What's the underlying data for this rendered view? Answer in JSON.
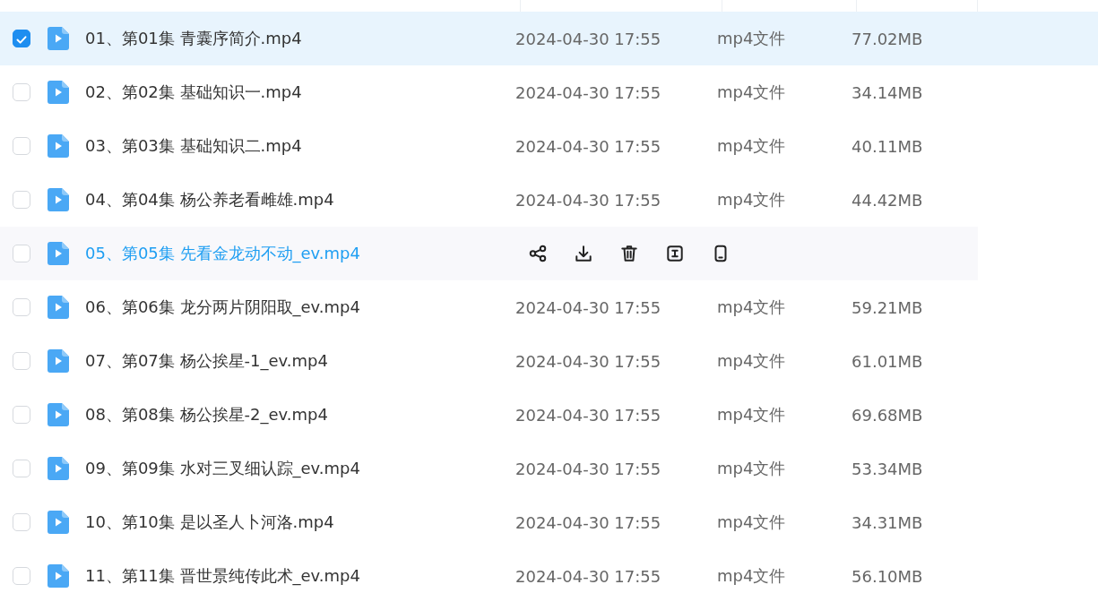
{
  "files": [
    {
      "name": "01、第01集 青囊序简介.mp4",
      "date": "2024-04-30 17:55",
      "type": "mp4文件",
      "size": "77.02MB",
      "checked": true,
      "selected": true,
      "hovered": false
    },
    {
      "name": "02、第02集 基础知识一.mp4",
      "date": "2024-04-30 17:55",
      "type": "mp4文件",
      "size": "34.14MB",
      "checked": false,
      "selected": false,
      "hovered": false
    },
    {
      "name": "03、第03集 基础知识二.mp4",
      "date": "2024-04-30 17:55",
      "type": "mp4文件",
      "size": "40.11MB",
      "checked": false,
      "selected": false,
      "hovered": false
    },
    {
      "name": "04、第04集 杨公养老看雌雄.mp4",
      "date": "2024-04-30 17:55",
      "type": "mp4文件",
      "size": "44.42MB",
      "checked": false,
      "selected": false,
      "hovered": false
    },
    {
      "name": "05、第05集 先看金龙动不动_ev.mp4",
      "checked": false,
      "selected": false,
      "hovered": true
    },
    {
      "name": "06、第06集 龙分两片阴阳取_ev.mp4",
      "date": "2024-04-30 17:55",
      "type": "mp4文件",
      "size": "59.21MB",
      "checked": false,
      "selected": false,
      "hovered": false
    },
    {
      "name": "07、第07集 杨公挨星-1_ev.mp4",
      "date": "2024-04-30 17:55",
      "type": "mp4文件",
      "size": "61.01MB",
      "checked": false,
      "selected": false,
      "hovered": false
    },
    {
      "name": "08、第08集 杨公挨星-2_ev.mp4",
      "date": "2024-04-30 17:55",
      "type": "mp4文件",
      "size": "69.68MB",
      "checked": false,
      "selected": false,
      "hovered": false
    },
    {
      "name": "09、第09集 水对三叉细认踪_ev.mp4",
      "date": "2024-04-30 17:55",
      "type": "mp4文件",
      "size": "53.34MB",
      "checked": false,
      "selected": false,
      "hovered": false
    },
    {
      "name": "10、第10集 是以圣人卜河洛.mp4",
      "date": "2024-04-30 17:55",
      "type": "mp4文件",
      "size": "34.31MB",
      "checked": false,
      "selected": false,
      "hovered": false
    },
    {
      "name": "11、第11集 晋世景纯传此术_ev.mp4",
      "date": "2024-04-30 17:55",
      "type": "mp4文件",
      "size": "56.10MB",
      "checked": false,
      "selected": false,
      "hovered": false
    }
  ]
}
